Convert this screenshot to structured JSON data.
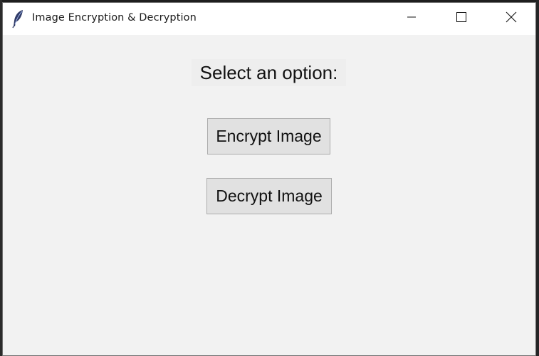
{
  "window": {
    "title": "Image Encryption & Decryption",
    "app_icon": "feather-icon",
    "controls": {
      "minimize_icon": "minimize-icon",
      "maximize_icon": "maximize-icon",
      "close_icon": "close-icon"
    }
  },
  "main": {
    "prompt": "Select an option:",
    "buttons": [
      {
        "label": "Encrypt Image"
      },
      {
        "label": "Decrypt Image"
      }
    ]
  },
  "colors": {
    "window_background": "#f2f2f2",
    "titlebar_background": "#ffffff",
    "button_background": "#e1e1e1",
    "button_border": "#adadad"
  }
}
